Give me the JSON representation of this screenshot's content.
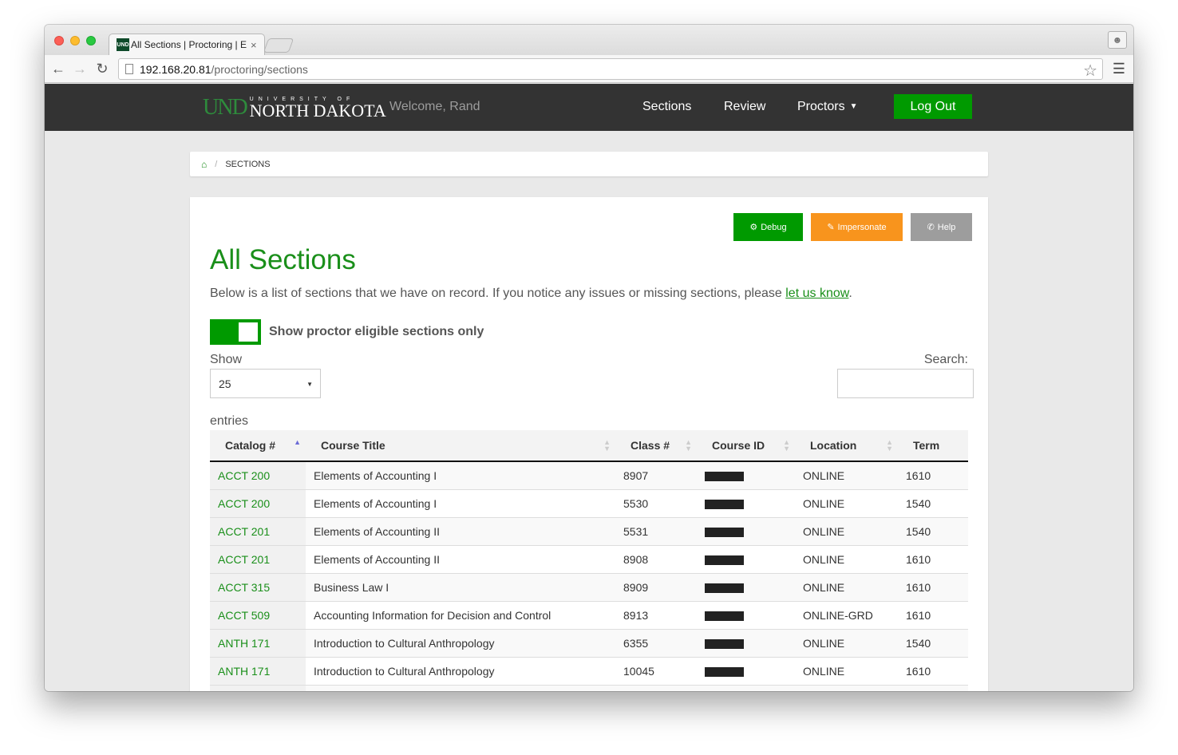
{
  "browser": {
    "tab_title": "All Sections | Proctoring | E",
    "favicon": "UND",
    "close": "×",
    "url_host": "192.168.20.81",
    "url_path": "/proctoring/sections"
  },
  "navbar": {
    "logo_und": "UND",
    "logo_small": "UNIVERSITY OF",
    "logo_big": "NORTH DAKOTA",
    "welcome": "Welcome, Rand",
    "links": {
      "sections": "Sections",
      "review": "Review",
      "proctors": "Proctors"
    },
    "logout": "Log Out"
  },
  "breadcrumb": {
    "current": "SECTIONS",
    "separator": "/"
  },
  "actions": {
    "debug": "Debug",
    "impersonate": "Impersonate",
    "help": "Help"
  },
  "page": {
    "title": "All Sections",
    "description_pre": "Below is a list of sections that we have on record. If you notice any issues or missing sections, please ",
    "description_link": "let us know",
    "description_post": ".",
    "toggle_label": "Show proctor eligible sections only",
    "show_label": "Show",
    "page_length": "25",
    "search_label": "Search:",
    "entries_label": "entries"
  },
  "table": {
    "headers": [
      "Catalog #",
      "Course Title",
      "Class #",
      "Course ID",
      "Location",
      "Term"
    ],
    "rows": [
      [
        "ACCT 200",
        "Elements of Accounting I",
        "8907",
        "",
        "ONLINE",
        "1610"
      ],
      [
        "ACCT 200",
        "Elements of Accounting I",
        "5530",
        "",
        "ONLINE",
        "1540"
      ],
      [
        "ACCT 201",
        "Elements of Accounting II",
        "5531",
        "",
        "ONLINE",
        "1540"
      ],
      [
        "ACCT 201",
        "Elements of Accounting II",
        "8908",
        "",
        "ONLINE",
        "1610"
      ],
      [
        "ACCT 315",
        "Business Law I",
        "8909",
        "",
        "ONLINE",
        "1610"
      ],
      [
        "ACCT 509",
        "Accounting Information for Decision and Control",
        "8913",
        "",
        "ONLINE-GRD",
        "1610"
      ],
      [
        "ANTH 171",
        "Introduction to Cultural Anthropology",
        "6355",
        "",
        "ONLINE",
        "1540"
      ],
      [
        "ANTH 171",
        "Introduction to Cultural Anthropology",
        "10045",
        "",
        "ONLINE",
        "1610"
      ],
      [
        "",
        "",
        "",
        "",
        "",
        ""
      ]
    ]
  },
  "colors": {
    "brand_green": "#009a00",
    "navbar": "#333333",
    "impersonate": "#f8941d",
    "help": "#9d9d9d"
  }
}
